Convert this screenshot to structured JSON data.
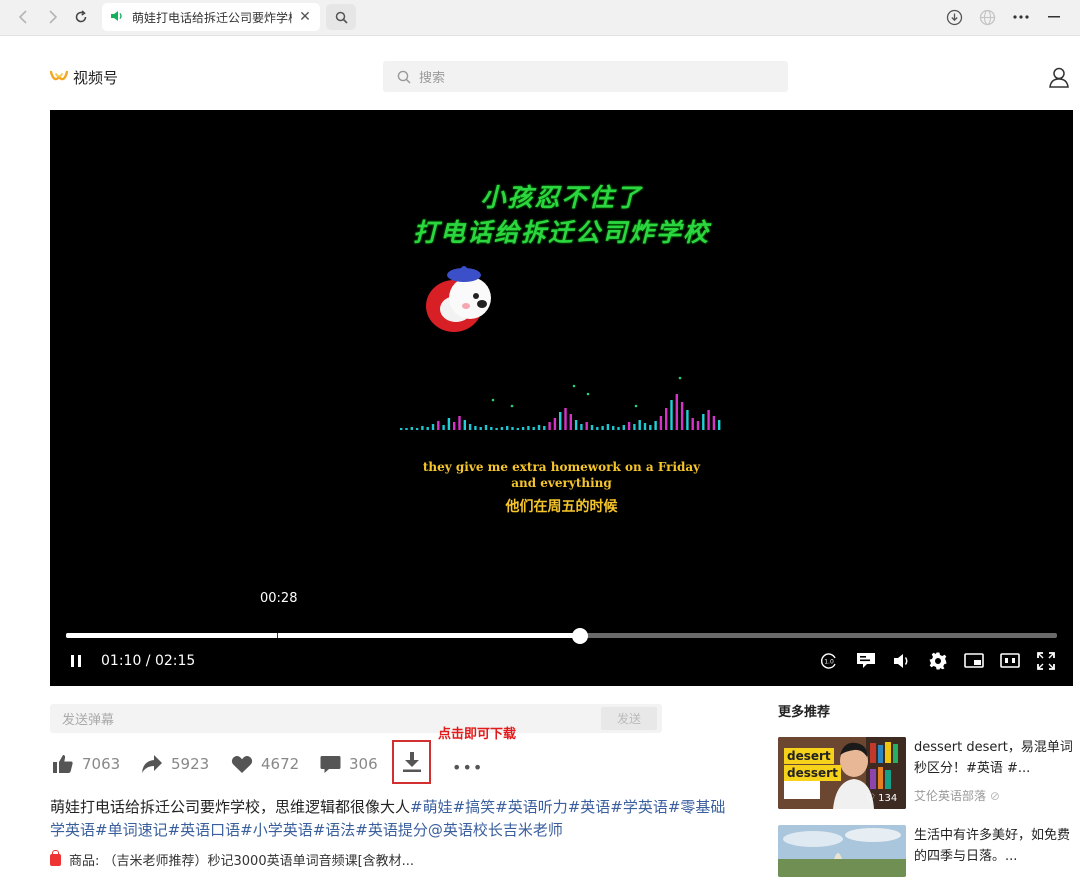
{
  "browser": {
    "tab_title": "萌娃打电话给拆迁公司要炸学校",
    "tab_close": "✕"
  },
  "site": {
    "logo_text": "视频号",
    "search_placeholder": "搜索"
  },
  "video": {
    "title_line1": "小孩忍不住了",
    "title_line2": "打电话给拆迁公司炸学校",
    "subtitle_en_line1": "they give me extra homework on a Friday",
    "subtitle_en_line2": "and everything",
    "subtitle_cn": "他们在周五的时候",
    "hover_time": "00:28",
    "time_display": "01:10 / 02:15",
    "progress": 0.519,
    "hover_marker": 0.213
  },
  "danmaku": {
    "placeholder": "发送弹幕",
    "send_label": "发送"
  },
  "download_tip": "点击即可下载",
  "actions": {
    "like_count": "7063",
    "share_count": "5923",
    "favorite_count": "4672",
    "comment_count": "306",
    "more_label": "•••"
  },
  "description": {
    "text": "萌娃打电话给拆迁公司要炸学校，思维逻辑都很像大人",
    "tags_line1": "#萌娃#搞笑#英语听力#英语#学英语#零基础",
    "tags_line2": "学英语#单词速记#英语口语#小学英语#语法#英语提分@英语校长吉米老师"
  },
  "product": {
    "text": "商品: （吉米老师推荐）秒记3000英语单词音频课[含教材..."
  },
  "recommendations": {
    "title": "更多推荐",
    "items": [
      {
        "title": "dessert desert，易混单词秒区分！#英语 #...",
        "author": "艾伦英语部落",
        "thumb_label_1": "desert",
        "thumb_label_2": "dessert",
        "thumb_badge": "134"
      },
      {
        "title": "生活中有许多美好，如免费的四季与日落。...",
        "author": ""
      }
    ]
  },
  "colors": {
    "title_green": "#2bd640",
    "subtitle_yellow": "#f5c52c",
    "tag_blue": "#3a5f9e",
    "tip_red": "#e21a1a"
  },
  "icons": [
    "back-icon",
    "forward-icon",
    "refresh-icon",
    "speaker-icon",
    "search-icon",
    "download-icon",
    "globe-icon",
    "more-icon",
    "minimize-icon",
    "user-icon",
    "pause-icon",
    "speed-icon",
    "danmaku-icon",
    "volume-icon",
    "settings-icon",
    "pip-icon",
    "widescreen-icon",
    "fullscreen-icon",
    "emoji-icon",
    "like-icon",
    "share-icon",
    "heart-icon",
    "comment-icon"
  ]
}
